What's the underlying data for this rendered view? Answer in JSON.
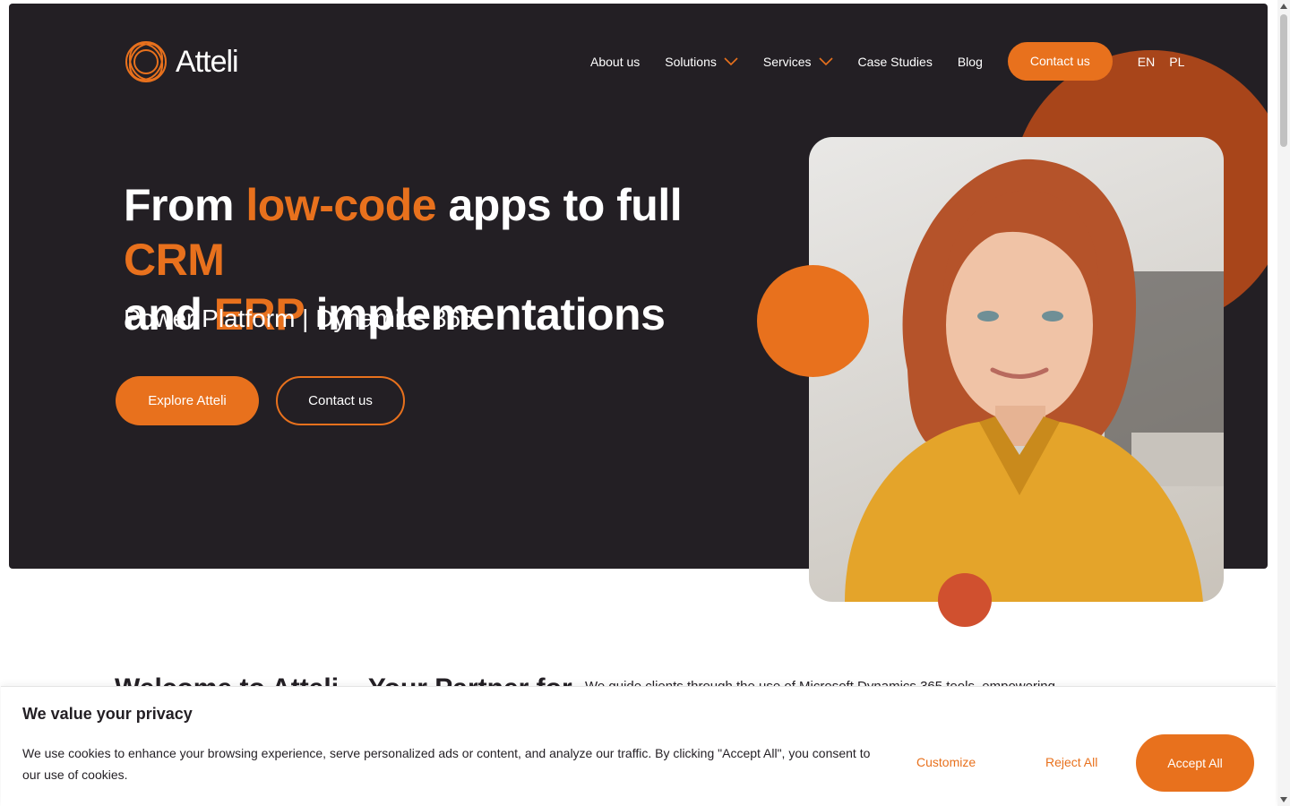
{
  "brand": {
    "name": "Atteli",
    "logo_icon": "atteli-rings-logo",
    "accent_color": "#e8711d",
    "dark_bg": "#231f24"
  },
  "nav": {
    "items": [
      {
        "label": "About us",
        "dropdown": false
      },
      {
        "label": "Solutions",
        "dropdown": true
      },
      {
        "label": "Services",
        "dropdown": true
      },
      {
        "label": "Case Studies",
        "dropdown": false
      },
      {
        "label": "Blog",
        "dropdown": false
      }
    ],
    "cta_label": "Contact us",
    "languages": [
      "EN",
      "PL"
    ]
  },
  "hero": {
    "headline": {
      "p1": "From ",
      "h1": "low-code",
      "p2": " apps to full ",
      "h2": "CRM",
      "p3": " and ",
      "h3": "ERP",
      "p4": " implementations"
    },
    "subheadline": "Power Platform | Dynamics 365",
    "primary_button": "Explore Atteli",
    "secondary_button": "Contact us"
  },
  "welcome": {
    "title": "Welcome to Atteli – Your Partner for",
    "body": "We guide clients through the use of Microsoft Dynamics 365 tools, empowering"
  },
  "cookie_banner": {
    "title": "We value your privacy",
    "text": "We use cookies to enhance your browsing experience, serve personalized ads or content, and analyze our traffic. By clicking \"Accept All\", you consent to our use of cookies.",
    "customize": "Customize",
    "reject": "Reject All",
    "accept": "Accept All"
  }
}
